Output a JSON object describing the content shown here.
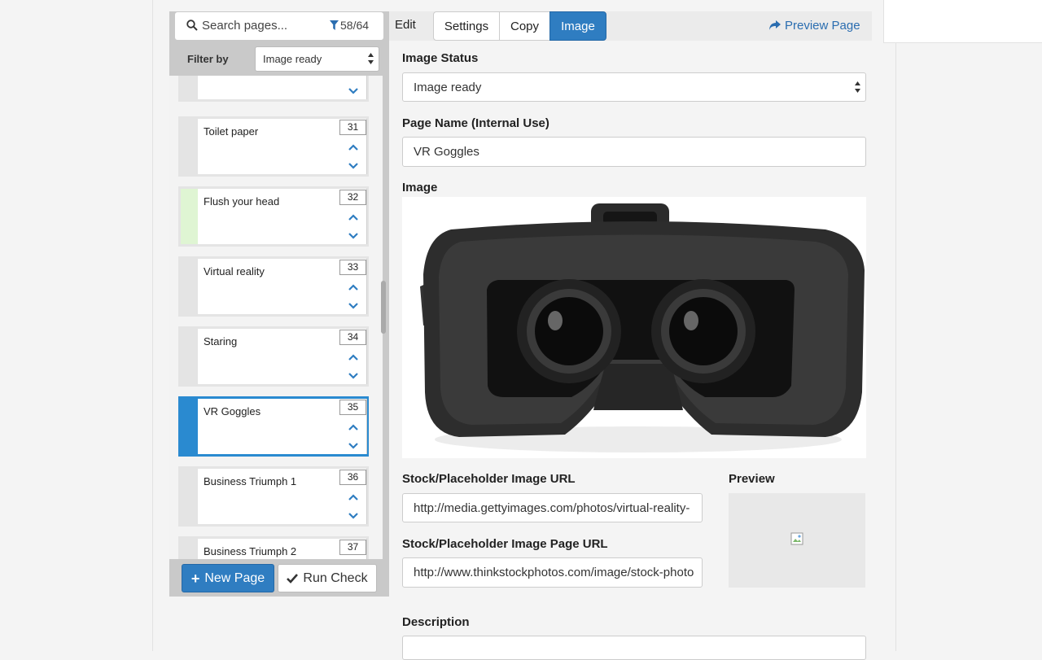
{
  "sidebar": {
    "search_placeholder": "Search pages...",
    "filter_count": "58/64",
    "filter_label": "Filter by",
    "filter_value": "Image ready",
    "pages": [
      {
        "title": "",
        "number": ""
      },
      {
        "title": "Toilet paper",
        "number": "31"
      },
      {
        "title": "Flush your head",
        "number": "32"
      },
      {
        "title": "Virtual reality",
        "number": "33"
      },
      {
        "title": "Staring",
        "number": "34"
      },
      {
        "title": "VR Goggles",
        "number": "35"
      },
      {
        "title": "Business Triumph 1",
        "number": "36"
      },
      {
        "title": "Business Triumph 2",
        "number": "37"
      }
    ],
    "new_page_label": "New Page",
    "run_check_label": "Run Check"
  },
  "tabs": {
    "edit_label": "Edit",
    "items": [
      "Settings",
      "Copy",
      "Image"
    ],
    "active": "Image",
    "preview_link": "Preview Page"
  },
  "form": {
    "image_status_label": "Image Status",
    "image_status_value": "Image ready",
    "page_name_label": "Page Name (Internal Use)",
    "page_name_value": "VR Goggles",
    "image_label": "Image",
    "stock_url_label": "Stock/Placeholder Image URL",
    "stock_url_value": "http://media.gettyimages.com/photos/virtual-reality-",
    "stock_page_url_label": "Stock/Placeholder Image Page URL",
    "stock_page_url_value": "http://www.thinkstockphotos.com/image/stock-photo",
    "preview_label": "Preview",
    "description_label": "Description"
  },
  "colors": {
    "accent": "#2f7dc1",
    "active_card": "#2a8ad0",
    "ready_stripe": "#dff5d3",
    "link": "#2a6db0"
  }
}
